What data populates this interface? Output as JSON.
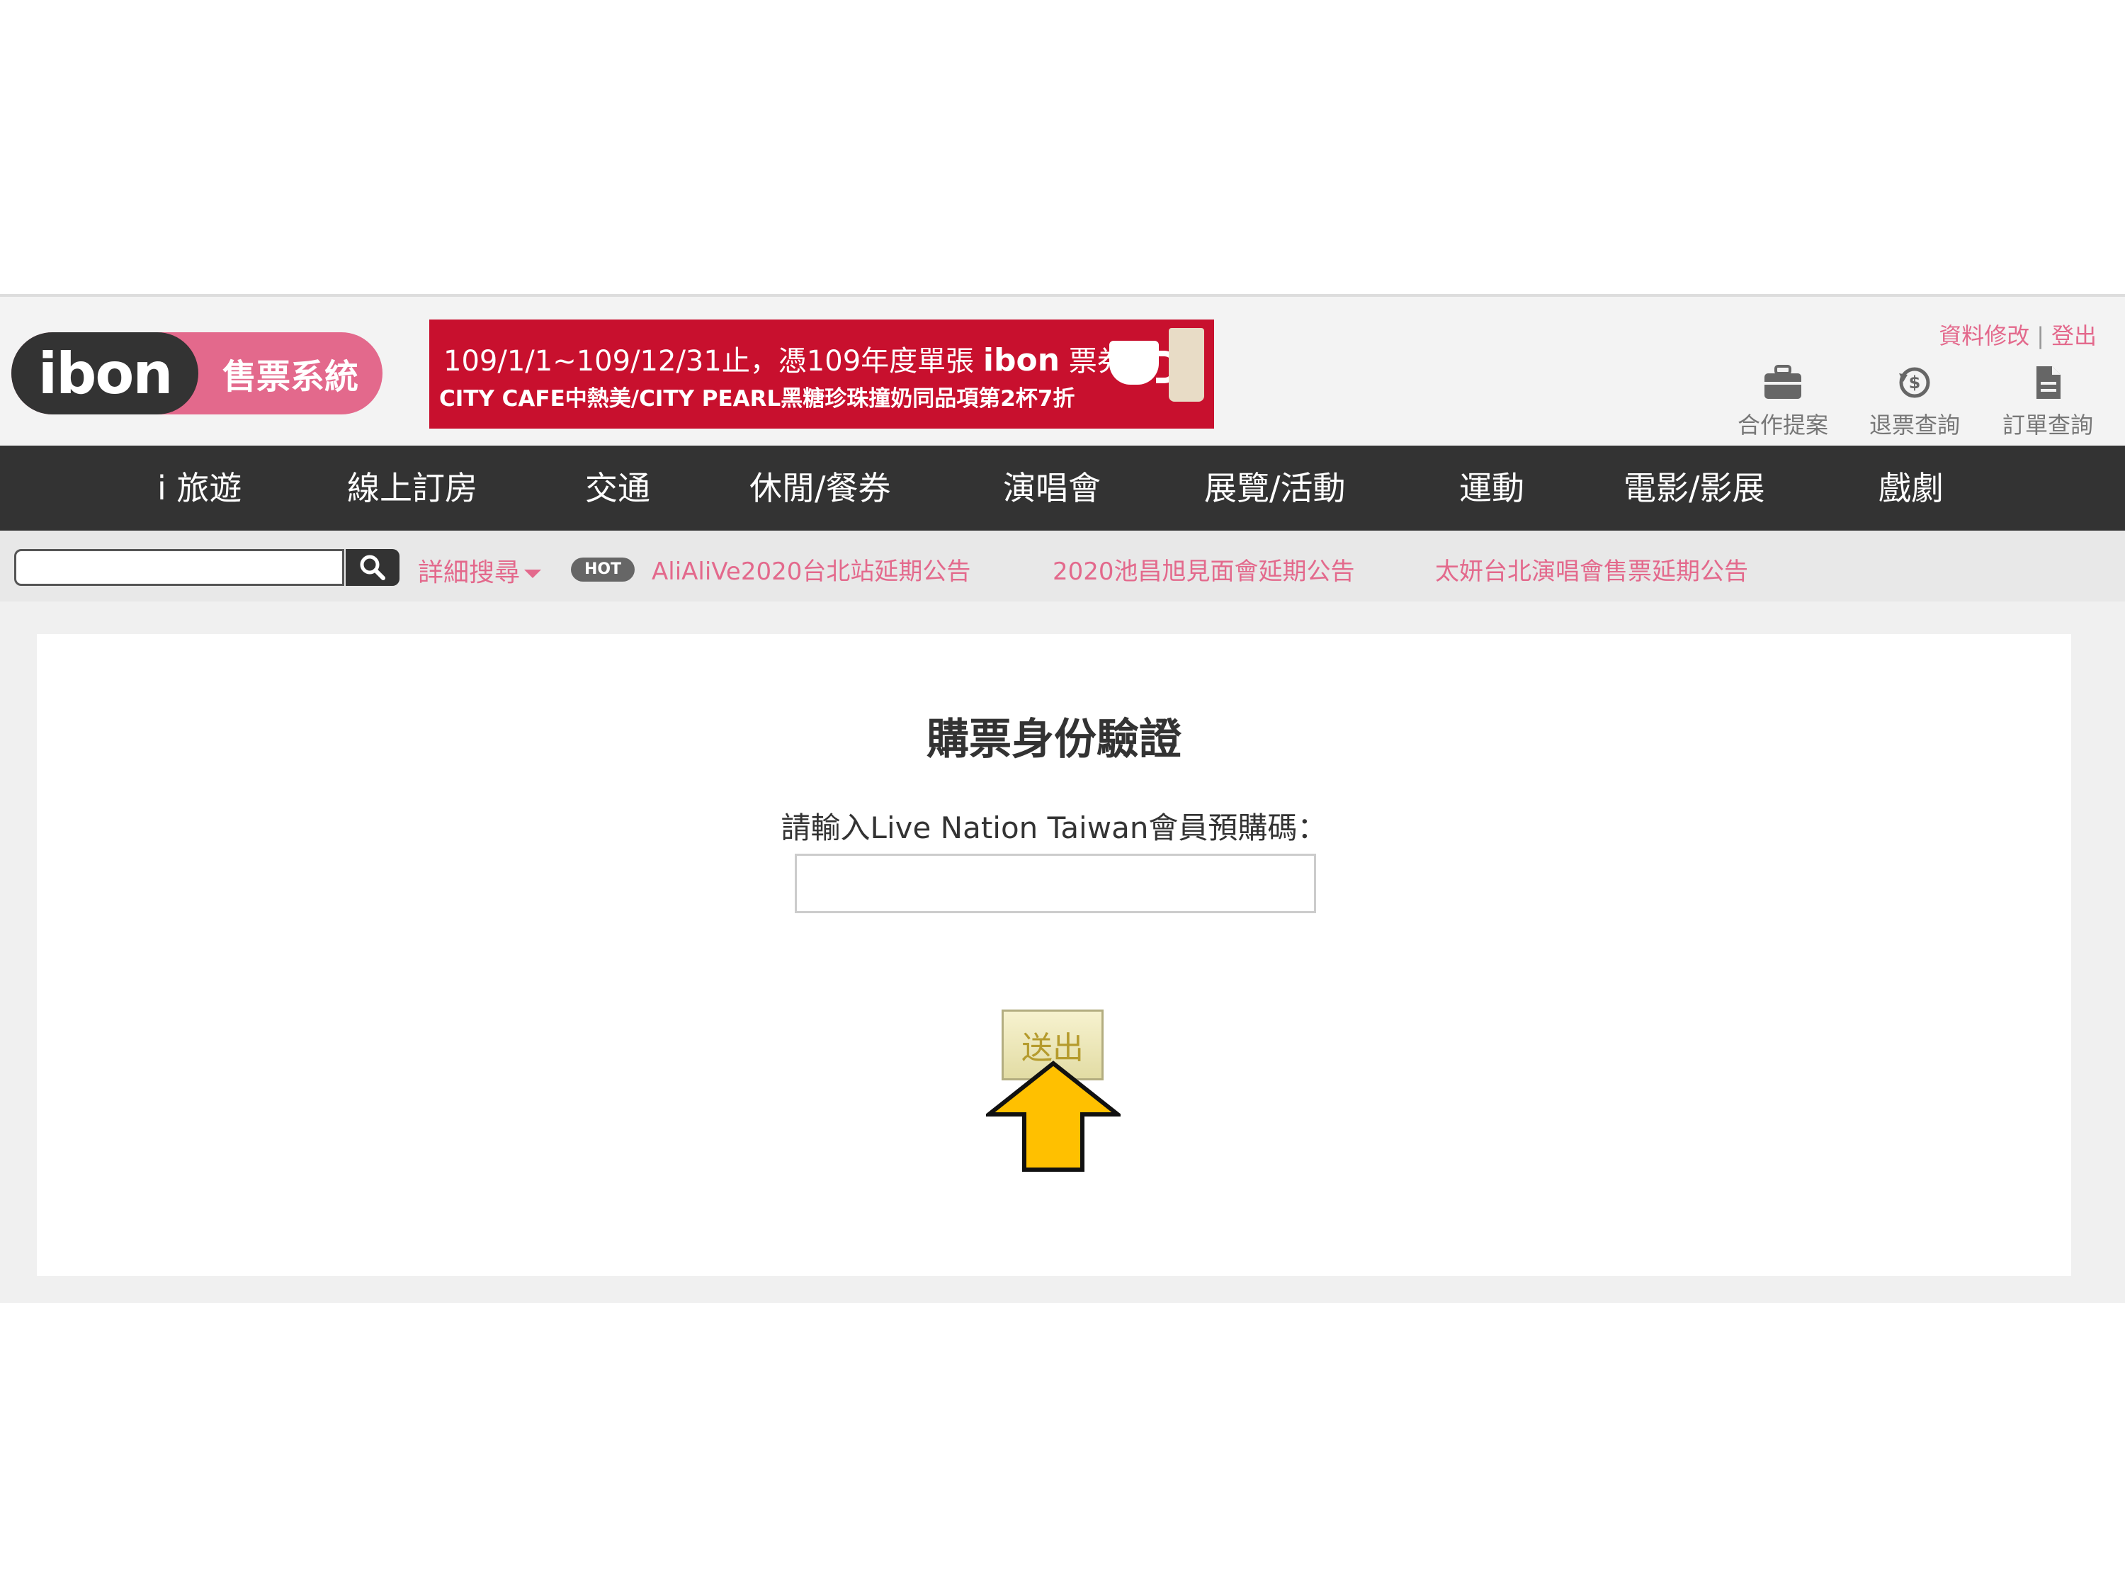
{
  "header": {
    "logo_text": "ibon",
    "logo_subtitle": "售票系統",
    "banner": {
      "line1": "109/1/1~109/12/31止，憑109年度單張",
      "line1_brand": "ibon",
      "line1_tail": "票券",
      "line2": "CITY CAFE中熱美/CITY PEARL黑糖珍珠撞奶同品項第2杯7折"
    },
    "top_links": {
      "profile": "資料修改",
      "separator": "|",
      "logout": "登出"
    },
    "quick_links": [
      {
        "label": "合作提案",
        "icon": "briefcase-icon"
      },
      {
        "label": "退票查詢",
        "icon": "refund-icon"
      },
      {
        "label": "訂單查詢",
        "icon": "document-icon"
      }
    ]
  },
  "nav": {
    "items": [
      "i 旅遊",
      "線上訂房",
      "交通",
      "休閒/餐券",
      "演唱會",
      "展覽/活動",
      "運動",
      "電影/影展",
      "戲劇"
    ]
  },
  "search": {
    "value": "",
    "advanced_label": "詳細搜尋",
    "hot_label": "HOT",
    "news": [
      "AliAliVe2020台北站延期公告",
      "2020池昌旭見面會延期公告",
      "太妍台北演唱會售票延期公告"
    ]
  },
  "main": {
    "title": "購票身份驗證",
    "prompt": "請輸入Live Nation Taiwan會員預購碼：",
    "code_value": "",
    "submit_label": "送出"
  },
  "colors": {
    "brand_pink": "#e3698c",
    "nav_bg": "#333333",
    "banner_red": "#c8102e",
    "arrow_fill": "#ffc000"
  }
}
